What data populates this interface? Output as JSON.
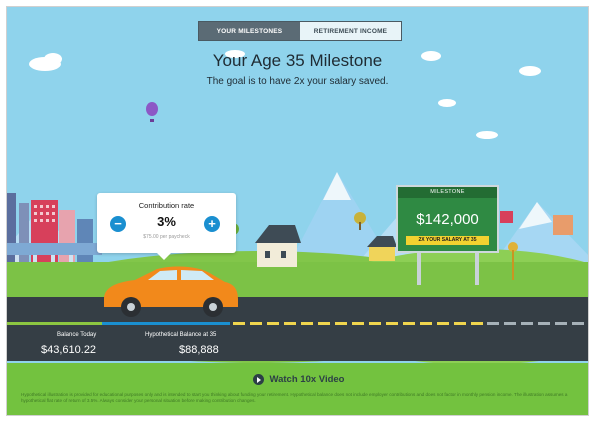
{
  "tabs": [
    {
      "label": "YOUR MILESTONES",
      "active": true
    },
    {
      "label": "RETIREMENT INCOME",
      "active": false
    }
  ],
  "header": {
    "title": "Your Age 35 Milestone",
    "subtitle": "The goal is to have 2x your salary saved."
  },
  "contribution": {
    "label": "Contribution rate",
    "value": "3%",
    "per_paycheck": "$75.00 per paycheck",
    "minus_symbol": "−",
    "plus_symbol": "+"
  },
  "milestone": {
    "header": "MILESTONE",
    "value": "$142,000",
    "badge": "2X YOUR SALARY AT 35"
  },
  "balances": {
    "today_label": "Balance Today",
    "today_value": "$43,610.22",
    "hypothetical_label": "Hypothetical Balance at 35",
    "hypothetical_value": "$88,888"
  },
  "footer": {
    "watch_label": "Watch 10x Video",
    "disclaimer": "Hypothetical illustration is provided for educational purposes only and is intended to start you thinking about funding your retirement. Hypothetical balance does not include employer contributions and does not factor in monthly pension income. The illustration assumes a hypothetical flat rate of return of 3.5%. Always consider your personal situation before making contribution changes."
  },
  "colors": {
    "sky": "#8fd3ec",
    "grass": "#73c23f",
    "road": "#353e45",
    "car": "#f2891b",
    "accent_blue": "#1a8fd0",
    "sign_green": "#2f8a43",
    "badge_yellow": "#f2d230"
  },
  "icons": {
    "contribution_minus": "minus-circle-icon",
    "contribution_plus": "plus-circle-icon",
    "watch_video": "play-circle-icon"
  }
}
